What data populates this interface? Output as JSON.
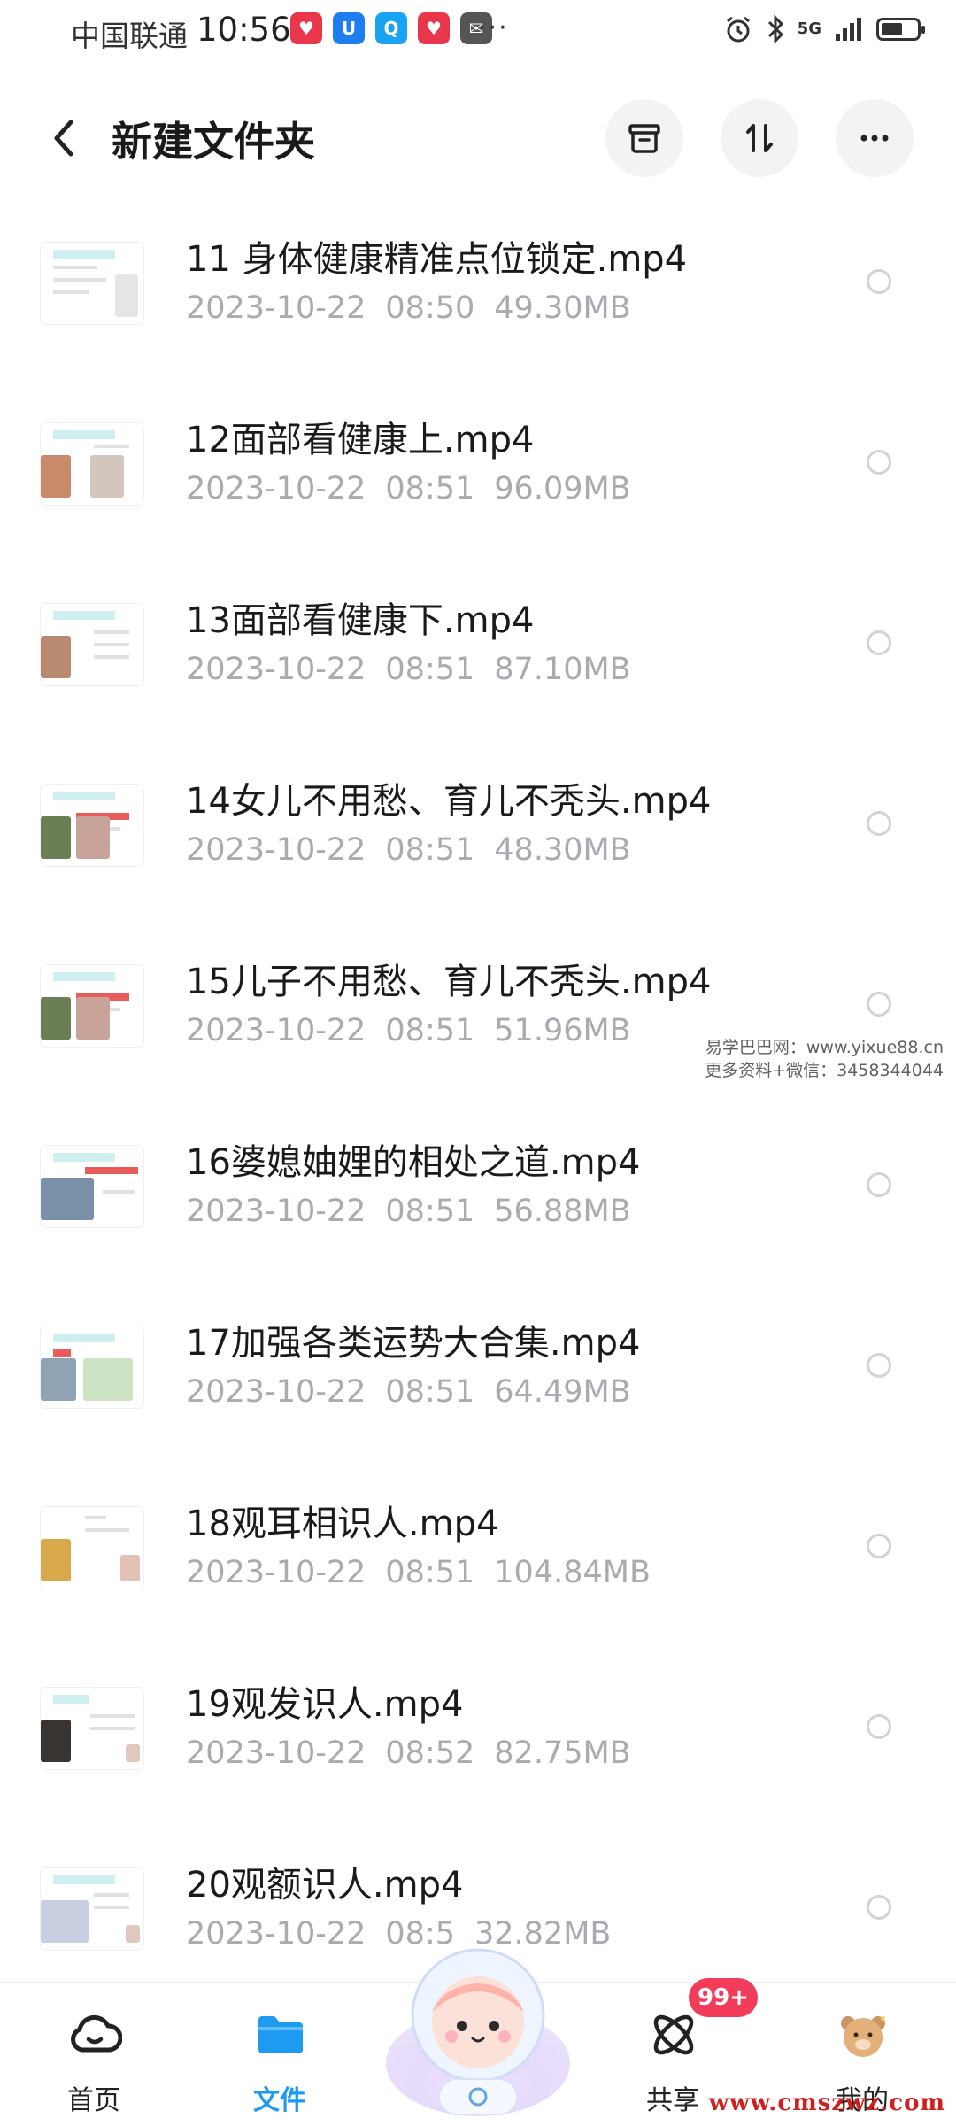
{
  "status_bar": {
    "carrier": "中国联通",
    "time": "10:56",
    "more": "···",
    "network": "5G",
    "battery_level": 0.6
  },
  "header": {
    "title": "新建文件夹"
  },
  "files": [
    {
      "name": "11 身体健康精准点位锁定.mp4",
      "date": "2023-10-22",
      "time": "08:50",
      "size": "49.30MB"
    },
    {
      "name": "12面部看健康上.mp4",
      "date": "2023-10-22",
      "time": "08:51",
      "size": "96.09MB"
    },
    {
      "name": "13面部看健康下.mp4",
      "date": "2023-10-22",
      "time": "08:51",
      "size": "87.10MB"
    },
    {
      "name": "14女儿不用愁、育儿不秃头.mp4",
      "date": "2023-10-22",
      "time": "08:51",
      "size": "48.30MB"
    },
    {
      "name": "15儿子不用愁、育儿不秃头.mp4",
      "date": "2023-10-22",
      "time": "08:51",
      "size": "51.96MB"
    },
    {
      "name": "16婆媳妯娌的相处之道.mp4",
      "date": "2023-10-22",
      "time": "08:51",
      "size": "56.88MB"
    },
    {
      "name": "17加强各类运势大合集.mp4",
      "date": "2023-10-22",
      "time": "08:51",
      "size": "64.49MB"
    },
    {
      "name": "18观耳相识人.mp4",
      "date": "2023-10-22",
      "time": "08:51",
      "size": "104.84MB"
    },
    {
      "name": "19观发识人.mp4",
      "date": "2023-10-22",
      "time": "08:52",
      "size": "82.75MB"
    },
    {
      "name": "20观额识人.mp4",
      "date": "2023-10-22",
      "time": "08:5",
      "size": "32.82MB"
    }
  ],
  "watermark": {
    "line1": "易学巴巴网：www.yixue88.cn",
    "line2": "更多资料+微信：3458344044",
    "bottom": "www.cmszwz.com"
  },
  "nav": {
    "home_label": "首页",
    "files_label": "文件",
    "share_label": "共享",
    "mine_label": "我的",
    "share_badge": "99+"
  },
  "colors": {
    "accent": "#1e9bf0",
    "badge": "#f23c5a",
    "meta_text": "#a8abb0"
  }
}
